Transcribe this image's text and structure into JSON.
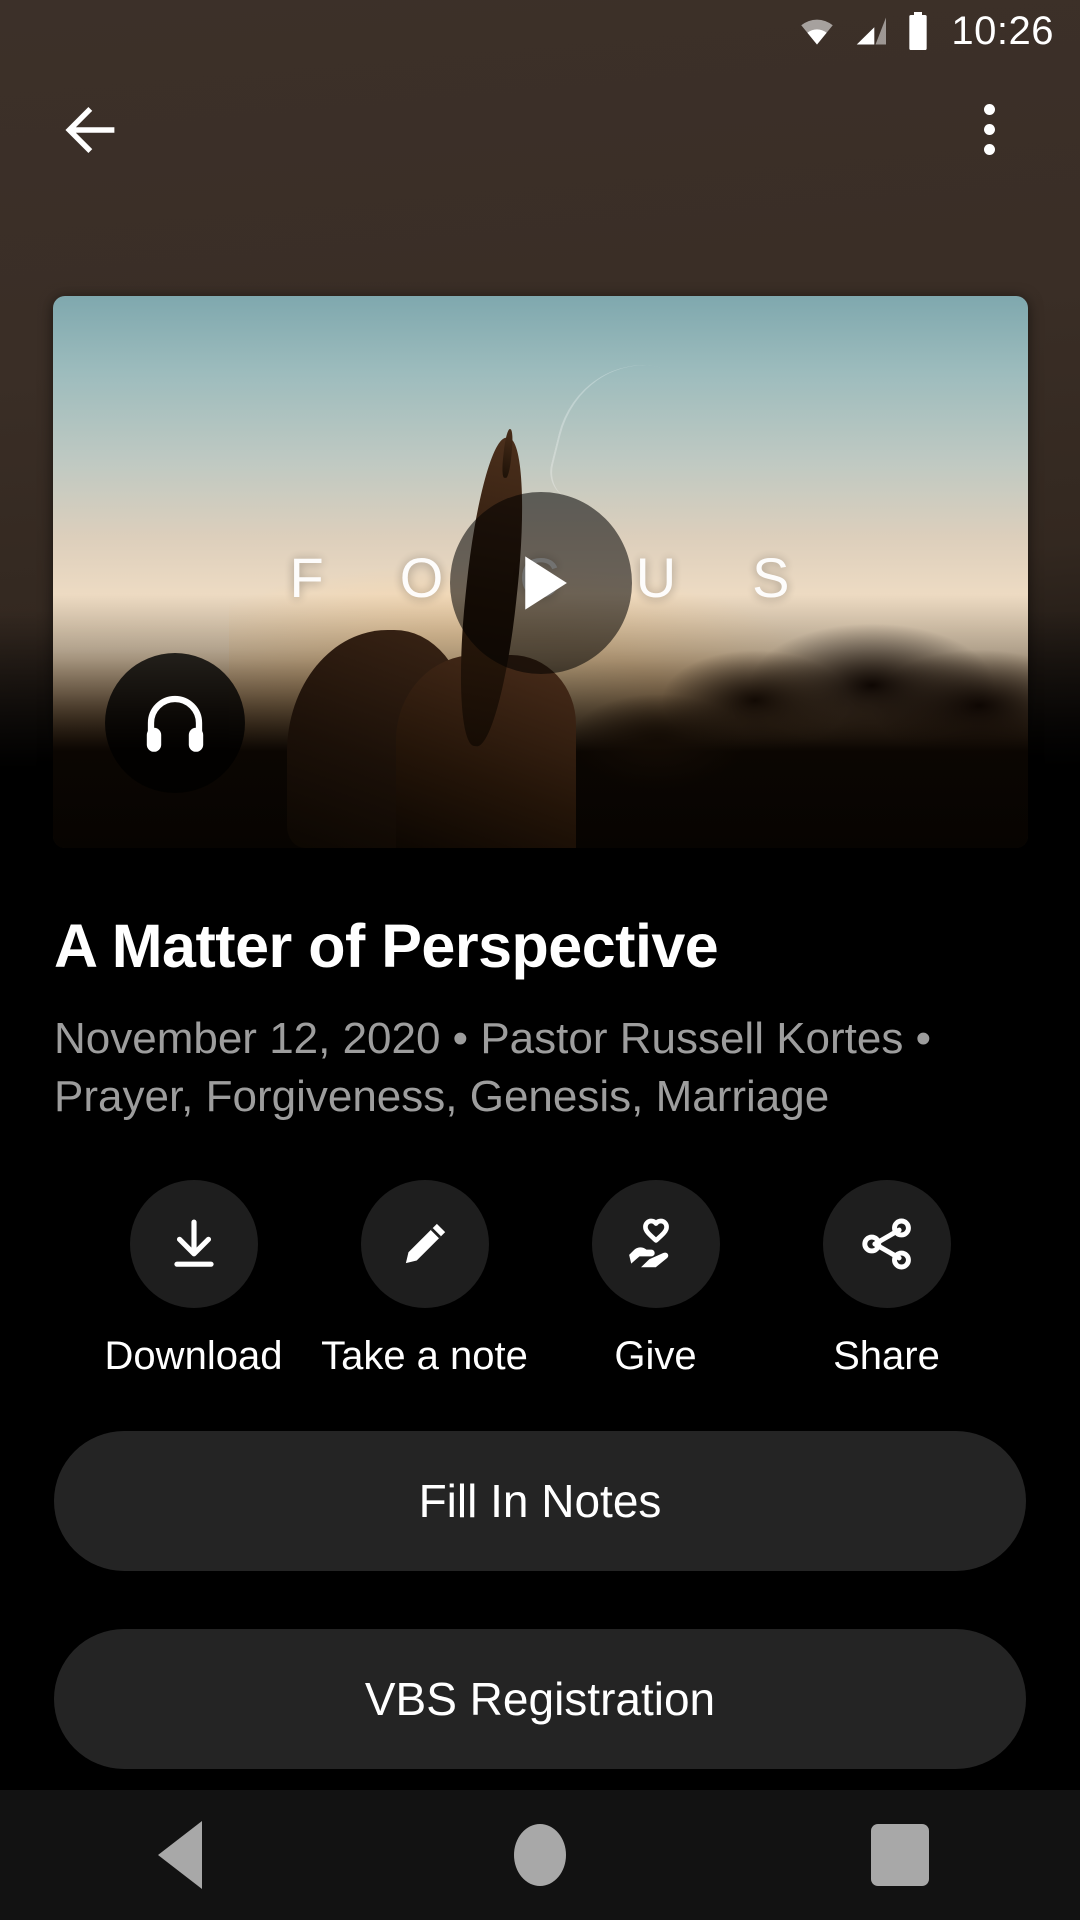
{
  "status_bar": {
    "time": "10:26",
    "icons": [
      "wifi-icon",
      "cellular-signal-icon",
      "battery-icon"
    ]
  },
  "app_bar": {
    "back_icon": "back-arrow-icon",
    "overflow_icon": "more-vertical-icon"
  },
  "hero": {
    "overlay_text": "FOCUS",
    "overlay_letters": [
      "F",
      "O",
      "C",
      "U",
      "S"
    ],
    "play_icon": "play-icon",
    "audio_icon": "headphones-icon"
  },
  "sermon": {
    "title": "A Matter of Perspective",
    "meta": "November 12, 2020 • Pastor Russell Kortes • Prayer, Forgiveness, Genesis, Marriage",
    "date": "November 12, 2020",
    "speaker": "Pastor Russell Kortes",
    "topics": "Prayer, Forgiveness, Genesis, Marriage"
  },
  "actions": [
    {
      "label": "Download",
      "icon": "download-icon"
    },
    {
      "label": "Take a note",
      "icon": "pencil-icon"
    },
    {
      "label": "Give",
      "icon": "hand-heart-icon"
    },
    {
      "label": "Share",
      "icon": "share-icon"
    }
  ],
  "links": [
    {
      "label": "Fill In Notes"
    },
    {
      "label": "VBS Registration"
    }
  ],
  "nav_bar": {
    "back": "nav-back-icon",
    "home": "nav-home-icon",
    "recents": "nav-recents-icon"
  },
  "colors": {
    "backdrop": "#3a2e26",
    "page_bg": "#000000",
    "surface": "#1e1e1e",
    "link_surface": "#242424",
    "text_primary": "#ffffff",
    "text_secondary": "#9d9d9d",
    "nav_bar": "#121212",
    "nav_icon": "#a8a8a8"
  }
}
